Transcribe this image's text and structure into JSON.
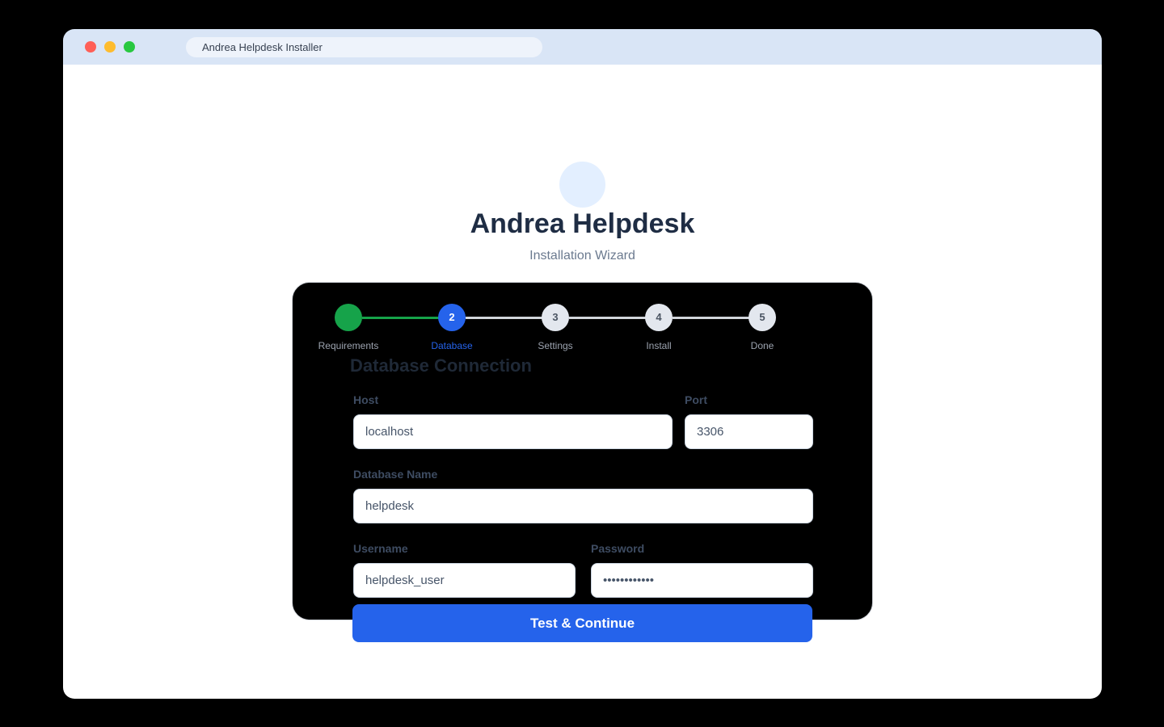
{
  "window": {
    "title": "Andrea Helpdesk Installer"
  },
  "header": {
    "app_name": "Andrea Helpdesk",
    "subtitle": "Installation Wizard"
  },
  "steps": [
    {
      "number": "",
      "label": "Requirements",
      "state": "complete"
    },
    {
      "number": "2",
      "label": "Database",
      "state": "active"
    },
    {
      "number": "3",
      "label": "Settings",
      "state": "pending"
    },
    {
      "number": "4",
      "label": "Install",
      "state": "pending"
    },
    {
      "number": "5",
      "label": "Done",
      "state": "pending"
    }
  ],
  "form": {
    "section_title": "Database Connection",
    "host": {
      "label": "Host",
      "value": "localhost"
    },
    "port": {
      "label": "Port",
      "value": "3306"
    },
    "database_name": {
      "label": "Database Name",
      "value": "helpdesk"
    },
    "username": {
      "label": "Username",
      "value": "helpdesk_user"
    },
    "password": {
      "label": "Password",
      "value": "••••••••••••"
    },
    "submit_label": "Test & Continue"
  },
  "colors": {
    "accent": "#2563eb",
    "success": "#16a34a",
    "titlebar": "#d9e5f6"
  }
}
